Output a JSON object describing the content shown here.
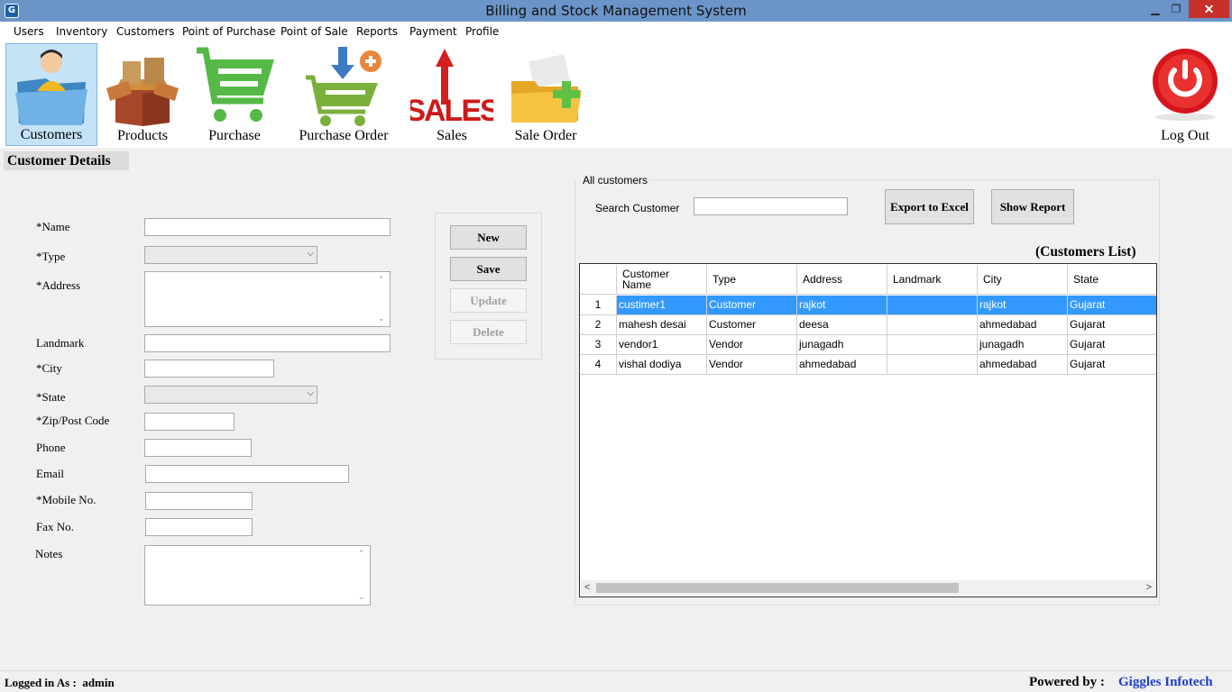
{
  "window": {
    "title": "Billing and Stock Management System",
    "minimize": "▁",
    "maximize": "❐",
    "close": "✕"
  },
  "menu": [
    "Users",
    "Inventory",
    "Customers",
    "Point of Purchase",
    "Point of Sale",
    "Reports",
    "Payment",
    "Profile"
  ],
  "toolbar": {
    "customers": "Customers",
    "products": "Products",
    "purchase": "Purchase",
    "purchase_order": "Purchase Order",
    "sales": "Sales",
    "sales_icon_text": "SALES",
    "sale_order": "Sale Order",
    "logout": "Log Out"
  },
  "form": {
    "section_title": "Customer Details",
    "labels": {
      "name": "*Name",
      "type": "*Type",
      "address": "*Address",
      "landmark": "Landmark",
      "city": "*City",
      "state": "*State",
      "zip": "*Zip/Post Code",
      "phone": "Phone",
      "email": "Email",
      "mobile": "*Mobile No.",
      "fax": "Fax No.",
      "notes": "Notes"
    },
    "buttons": {
      "new": "New",
      "save": "Save",
      "update": "Update",
      "delete": "Delete"
    }
  },
  "customers_panel": {
    "group_title": "All customers",
    "search_label": "Search Customer",
    "search_value": "",
    "export_button": "Export to Excel",
    "report_button": "Show Report",
    "list_caption": "(Customers List)",
    "columns": [
      "Customer Name",
      "Type",
      "Address",
      "Landmark",
      "City",
      "State"
    ],
    "rows": [
      {
        "num": "1",
        "cells": [
          "custimer1",
          "Customer",
          "rajkot",
          "",
          "rajkot",
          "Gujarat"
        ],
        "selected": true
      },
      {
        "num": "2",
        "cells": [
          "mahesh desai",
          "Customer",
          "deesa",
          "",
          "ahmedabad",
          "Gujarat"
        ],
        "selected": false
      },
      {
        "num": "3",
        "cells": [
          "vendor1",
          "Vendor",
          "junagadh",
          "",
          "junagadh",
          "Gujarat"
        ],
        "selected": false
      },
      {
        "num": "4",
        "cells": [
          "vishal dodiya",
          "Vendor",
          "ahmedabad",
          "",
          "ahmedabad",
          "Gujarat"
        ],
        "selected": false
      }
    ]
  },
  "status": {
    "logged_in_label": "Logged in As :",
    "user": "admin",
    "powered_label": "Powered by :",
    "company": "Giggles Infotech"
  }
}
